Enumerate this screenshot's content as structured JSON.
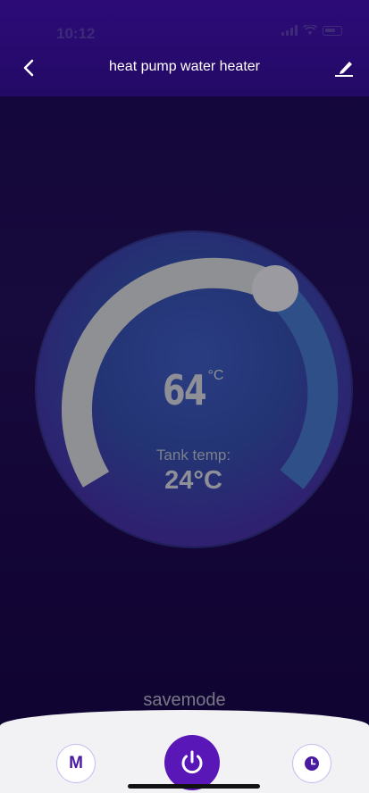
{
  "status_bar": {
    "time": "10:12"
  },
  "header": {
    "title": "heat pump water heater",
    "back_icon": "chevron-left-icon",
    "edit_icon": "edit-pencil-icon"
  },
  "thermostat": {
    "set_temperature": "64",
    "set_temperature_unit": "°C",
    "tank_label": "Tank temp:",
    "tank_temperature": "24°C"
  },
  "mode": {
    "current": "savemode"
  },
  "controls": {
    "mode_button_label": "M",
    "power_icon": "power-icon",
    "timer_icon": "clock-icon"
  },
  "colors": {
    "header_bg": "#2c0b78",
    "screen_bg": "#13053a",
    "accent": "#5a17b8",
    "dial_track": "#8f9094"
  }
}
